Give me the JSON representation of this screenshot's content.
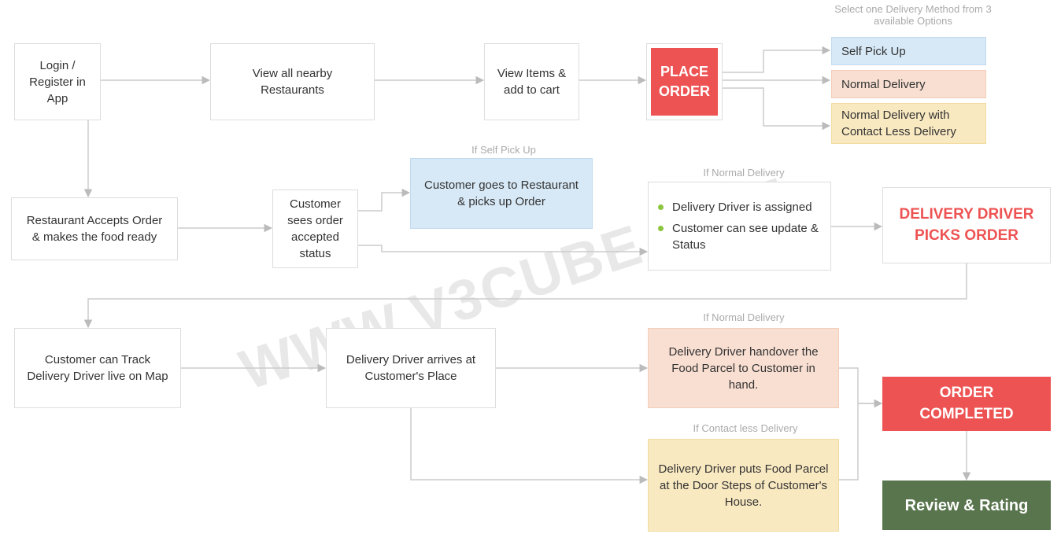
{
  "watermark": "WWW.V3CUBE.COM",
  "row1": {
    "login": "Login / Register in App",
    "view_nearby": "View all nearby Restaurants",
    "view_items": "View Items & add to cart",
    "place_order": "PLACE ORDER",
    "delivery_caption": "Select one Delivery Method from 3 available Options",
    "opt_self": "Self Pick Up",
    "opt_normal": "Normal Delivery",
    "opt_contactless": "Normal Delivery with Contact Less Delivery"
  },
  "row2": {
    "restaurant_accepts": "Restaurant Accepts Order & makes the food ready",
    "customer_status": "Customer sees order accepted status",
    "if_self_caption": "If Self Pick Up",
    "self_pickup_action": "Customer goes to Restaurant & picks up Order",
    "if_normal_caption": "If Normal Delivery",
    "bullets": {
      "b1": "Delivery Driver is assigned",
      "b2": "Customer can see update & Status"
    },
    "driver_picks": "DELIVERY DRIVER PICKS ORDER"
  },
  "row3": {
    "track": "Customer can Track Delivery Driver live on Map",
    "arrives": "Delivery Driver arrives at Customer's Place",
    "if_normal_caption": "If Normal Delivery",
    "handover": "Delivery Driver handover the Food Parcel to Customer in hand.",
    "if_contactless_caption": "If Contact less Delivery",
    "doorstep": "Delivery Driver puts Food Parcel at the Door Steps of Customer's House.",
    "completed": "ORDER COMPLETED",
    "review": "Review & Rating"
  }
}
